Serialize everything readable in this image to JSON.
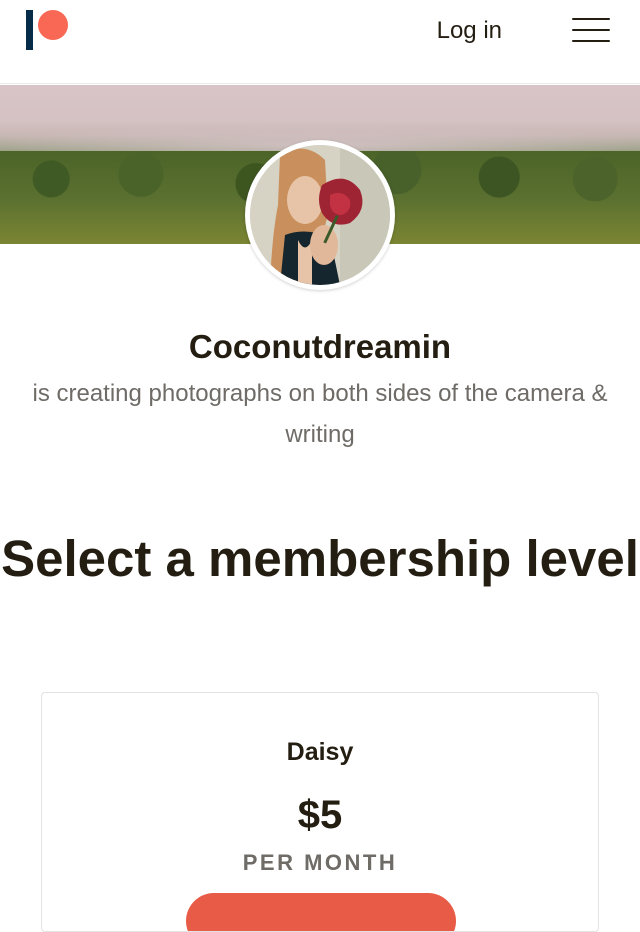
{
  "header": {
    "login_label": "Log in",
    "brand_colors": {
      "bar": "#052d49",
      "circle": "#f96854"
    },
    "icons": [
      "patreon-logo-icon",
      "hamburger-menu-icon"
    ]
  },
  "creator": {
    "name": "Coconutdreamin",
    "description": "is creating photographs on both sides of the camera & writing"
  },
  "main": {
    "section_title": "Select a membership level"
  },
  "tiers": [
    {
      "name": "Daisy",
      "price": "$5",
      "period": "PER MONTH",
      "button_color": "#e85b46"
    }
  ]
}
